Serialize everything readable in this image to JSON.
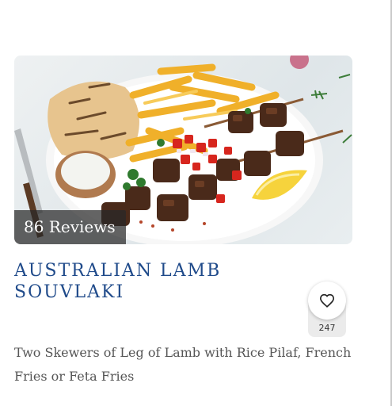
{
  "recipe": {
    "reviews_label": "86 Reviews",
    "title": "Australian Lamb Souvlaki",
    "favorite_count": "247",
    "description": "Two Skewers of Leg of Lamb with Rice Pilaf, French Fries or Feta Fries"
  },
  "icons": {
    "favorite": "heart-outline-icon"
  },
  "colors": {
    "title": "#1f4a8a",
    "description": "#555555",
    "reviews_overlay": "#282828"
  }
}
